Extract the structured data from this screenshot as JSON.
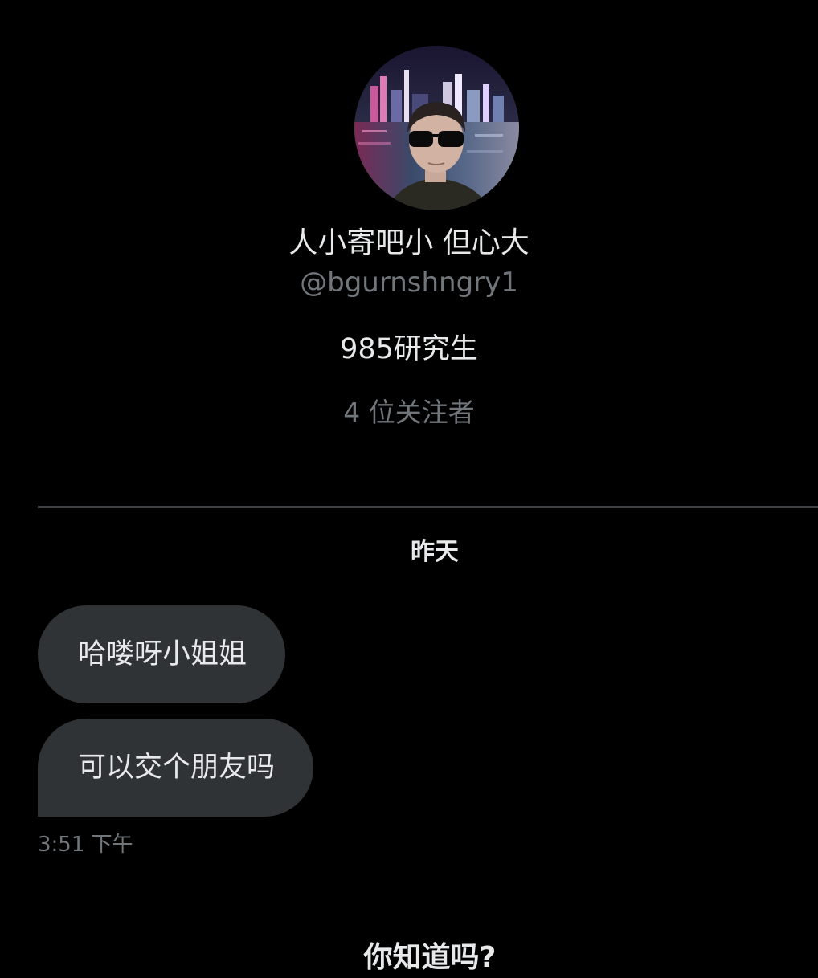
{
  "profile": {
    "display_name": "人小寄吧小 但心大",
    "handle": "@bgurnshngry1",
    "bio": "985研究生",
    "followers": "4 位关注者"
  },
  "conversation": {
    "date_separator": "昨天",
    "messages": [
      {
        "text": "哈喽呀小姐姐"
      },
      {
        "text": "可以交个朋友吗"
      }
    ],
    "timestamp": "3:51 下午"
  },
  "footer": {
    "did_you_know": "你知道吗?"
  },
  "colors": {
    "background": "#000000",
    "primary_text": "#e7e9ea",
    "secondary_text": "#71767b",
    "bubble": "#2f3336",
    "divider": "#3e4144"
  }
}
